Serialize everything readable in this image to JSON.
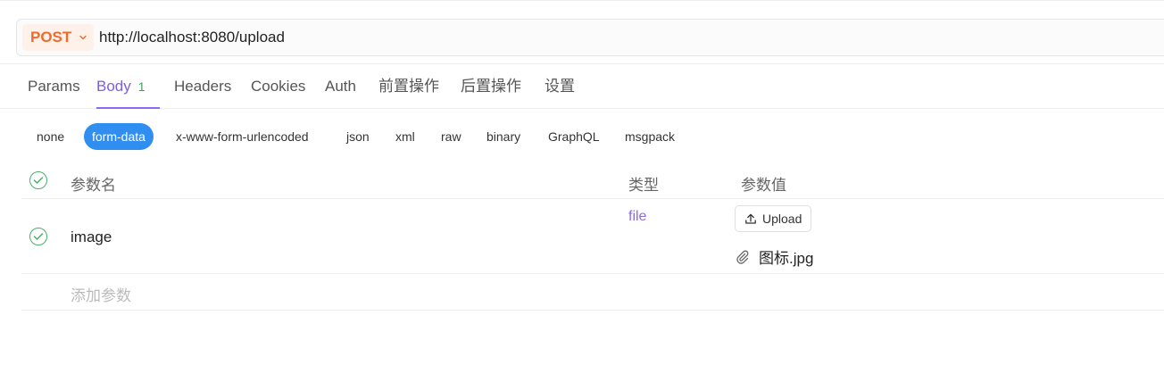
{
  "request": {
    "method": "POST",
    "url": "http://localhost:8080/upload"
  },
  "tabs": [
    {
      "label": "Params"
    },
    {
      "label": "Body",
      "badge": "1",
      "active": true
    },
    {
      "label": "Headers"
    },
    {
      "label": "Cookies"
    },
    {
      "label": "Auth"
    },
    {
      "label": "前置操作"
    },
    {
      "label": "后置操作"
    },
    {
      "label": "设置"
    }
  ],
  "body_types": [
    {
      "label": "none"
    },
    {
      "label": "form-data",
      "active": true
    },
    {
      "label": "x-www-form-urlencoded"
    },
    {
      "label": "json"
    },
    {
      "label": "xml"
    },
    {
      "label": "raw"
    },
    {
      "label": "binary"
    },
    {
      "label": "GraphQL"
    },
    {
      "label": "msgpack"
    }
  ],
  "table": {
    "headers": {
      "name": "参数名",
      "type": "类型",
      "value": "参数值"
    },
    "rows": [
      {
        "checked": true,
        "name": "image",
        "type": "file",
        "upload_label": "Upload",
        "file_name": "图标.jpg"
      }
    ],
    "add_placeholder": "添加参数"
  },
  "colors": {
    "method": "#ec6b2d",
    "active_tab": "#7d5de0",
    "active_body_type": "#2f8ef0",
    "checkbox": "#49b06a"
  }
}
